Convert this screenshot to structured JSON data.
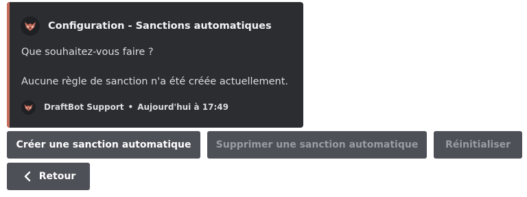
{
  "embed": {
    "accent_color": "#c56c5a",
    "author_icon": "draftbot-wolf-icon",
    "author_name": "Configuration - Sanctions automatiques",
    "description_line1": "Que souhaitez-vous faire ?",
    "description_line2": "Aucune règle de sanction n'a été créée actuellement.",
    "footer": {
      "icon": "draftbot-wolf-icon",
      "name": "DraftBot Support",
      "separator": "•",
      "timestamp": "Aujourd'hui à 17:49"
    }
  },
  "buttons": {
    "create_label": "Créer une sanction automatique",
    "delete_label": "Supprimer une sanction automatique",
    "reset_label": "Réinitialiser",
    "back_label": "Retour",
    "back_icon": "chevron-left-icon"
  }
}
